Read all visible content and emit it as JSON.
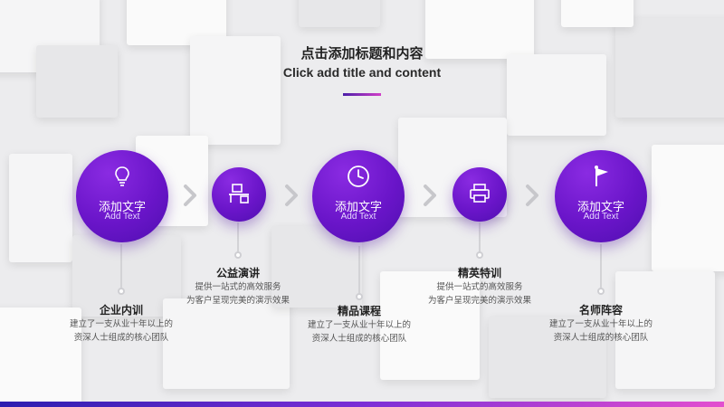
{
  "header": {
    "title_cn": "点击添加标题和内容",
    "title_en": "Click add title and content"
  },
  "accent": {
    "start": "#4b1ea8",
    "end": "#d23fc8",
    "circle": "#6a15c9"
  },
  "steps": [
    {
      "icon": "lightbulb-icon",
      "circle_title": "添加文字",
      "circle_sub": "Add Text",
      "label": "企业内训",
      "desc1": "建立了一支从业十年以上的",
      "desc2": "资深人士组成的核心团队"
    },
    {
      "icon": "desk-icon",
      "label": "公益演讲",
      "desc1": "提供一站式的高效服务",
      "desc2": "为客户呈现完美的演示效果"
    },
    {
      "icon": "clock-icon",
      "circle_title": "添加文字",
      "circle_sub": "Add Text",
      "label": "精品课程",
      "desc1": "建立了一支从业十年以上的",
      "desc2": "资深人士组成的核心团队"
    },
    {
      "icon": "printer-icon",
      "label": "精英特训",
      "desc1": "提供一站式的高效服务",
      "desc2": "为客户呈现完美的演示效果"
    },
    {
      "icon": "flag-icon",
      "circle_title": "添加文字",
      "circle_sub": "Add Text",
      "label": "名师阵容",
      "desc1": "建立了一支从业十年以上的",
      "desc2": "资深人士组成的核心团队"
    }
  ]
}
